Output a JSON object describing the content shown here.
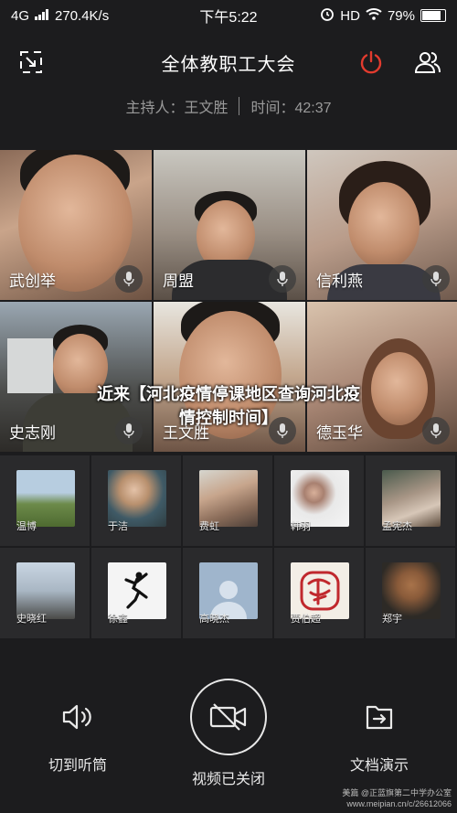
{
  "status_bar": {
    "network": "4G",
    "speed": "270.4K/s",
    "time": "下午5:22",
    "hd": "HD",
    "battery": "79%"
  },
  "header": {
    "title": "全体教职工大会",
    "host_label": "主持人：王文胜",
    "time_label": "时间：42:37",
    "colors": {
      "power": "#e23b2e"
    }
  },
  "main_tiles": [
    {
      "name": "武创举"
    },
    {
      "name": "周盟"
    },
    {
      "name": "信利燕"
    },
    {
      "name": "史志刚"
    },
    {
      "name": "王文胜"
    },
    {
      "name": "德玉华"
    }
  ],
  "small_tiles": [
    {
      "name": "温博"
    },
    {
      "name": "于洁"
    },
    {
      "name": "费虹"
    },
    {
      "name": "韩羽"
    },
    {
      "name": "孟宪杰"
    },
    {
      "name": "史晓红"
    },
    {
      "name": "徐鑫"
    },
    {
      "name": "高晓杰"
    },
    {
      "name": "贾伯超"
    },
    {
      "name": "郑宇"
    }
  ],
  "overlay": {
    "line1": "近来【河北疫情停课地区查询河北疫",
    "line2": "情控制时间】"
  },
  "controls": {
    "earpiece": "切到听筒",
    "video": "视频已关闭",
    "document": "文档演示"
  },
  "watermark": {
    "line1": "美篇 @正蓝旗第二中学办公室",
    "line2": "www.meipian.cn/c/26612066"
  }
}
